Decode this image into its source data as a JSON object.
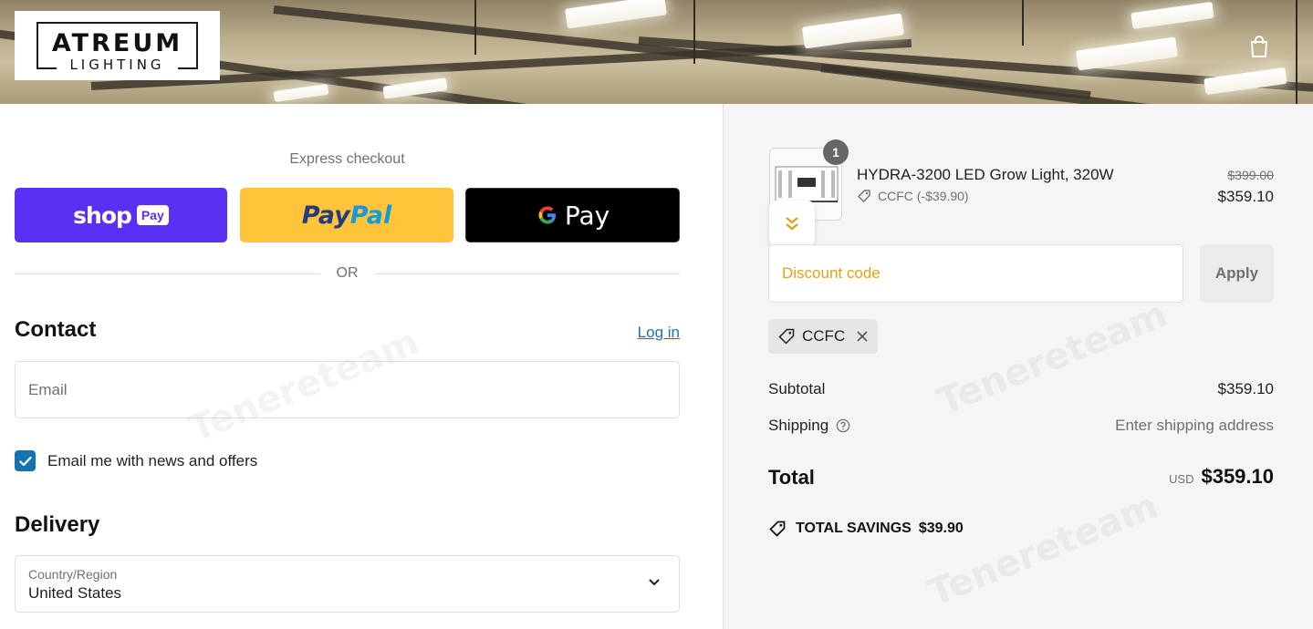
{
  "header": {
    "logo_main": "ATREUM",
    "logo_sub": "LIGHTING",
    "cart_icon": "shopping-bag-icon"
  },
  "express": {
    "title": "Express checkout",
    "shop_pay_word": "shop",
    "shop_pay_badge": "Pay",
    "paypal_pay": "Pay",
    "paypal_pal": "Pal",
    "gpay_word": "Pay",
    "or": "OR"
  },
  "contact": {
    "heading": "Contact",
    "login": "Log in",
    "email_placeholder": "Email",
    "newsletter_label": "Email me with news and offers",
    "newsletter_checked": true
  },
  "delivery": {
    "heading": "Delivery",
    "country_label": "Country/Region",
    "country_value": "United States"
  },
  "summary": {
    "item": {
      "quantity": "1",
      "name": "HYDRA-3200 LED Grow Light, 320W",
      "discount": "CCFC (-$39.90)",
      "original_price": "$399.00",
      "price": "$359.10"
    },
    "discount_placeholder": "Discount code",
    "apply": "Apply",
    "applied_code": "CCFC",
    "subtotal_label": "Subtotal",
    "subtotal_value": "$359.10",
    "shipping_label": "Shipping",
    "shipping_value": "Enter shipping address",
    "total_label": "Total",
    "currency": "USD",
    "total_value": "$359.10",
    "savings_label": "TOTAL SAVINGS",
    "savings_value": "$39.90"
  },
  "colors": {
    "shop_pay": "#5a31f4",
    "paypal": "#ffc439",
    "gpay": "#000000",
    "link": "#1773b0",
    "discount_placeholder": "#e0a21a"
  },
  "watermark": "Tenereteam"
}
